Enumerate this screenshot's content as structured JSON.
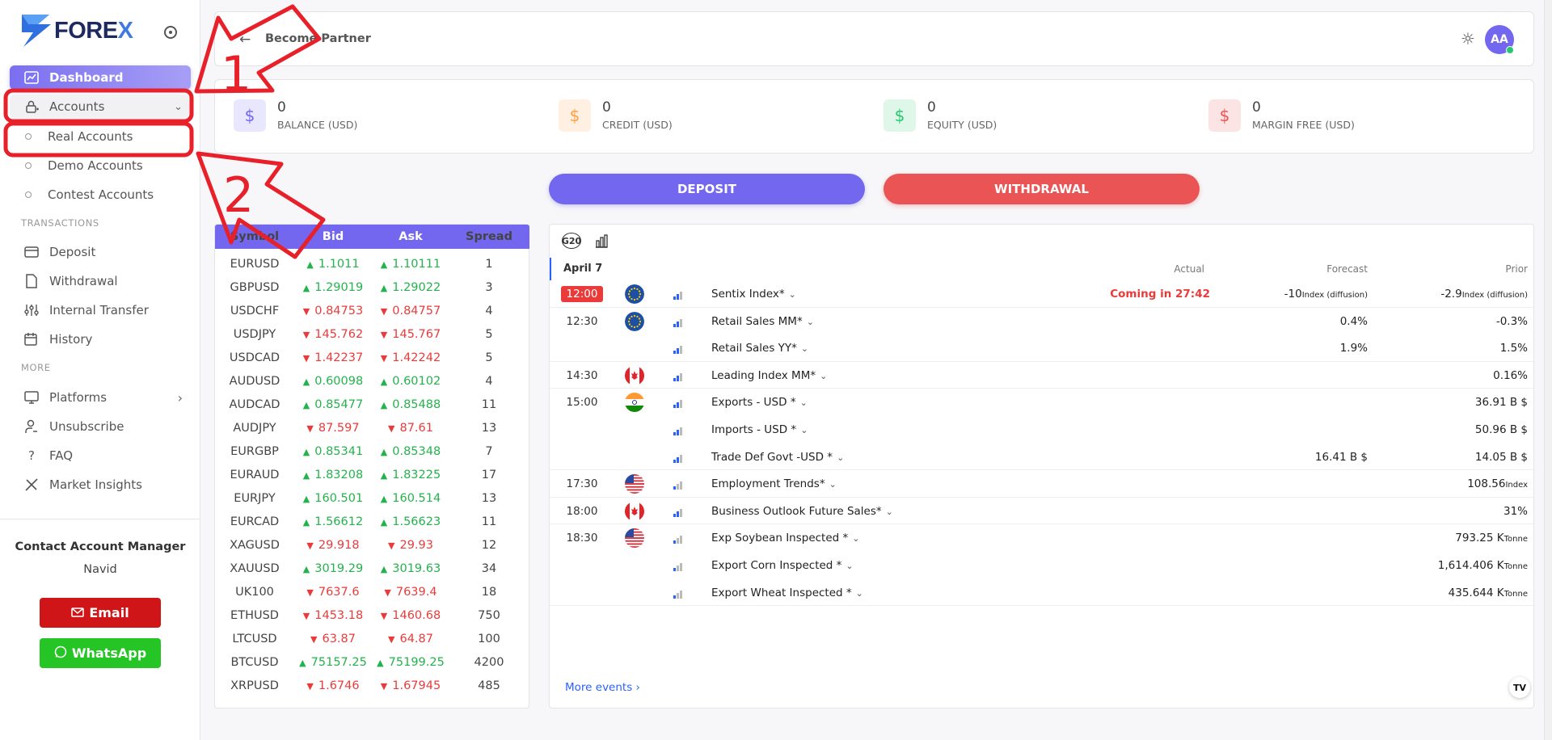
{
  "app": {
    "logo_text_main": "FORE",
    "logo_text_x": "X"
  },
  "sidebar": {
    "dashboard": "Dashboard",
    "accounts": "Accounts",
    "accounts_sub": [
      "Real Accounts",
      "Demo Accounts",
      "Contest Accounts"
    ],
    "transactions_label": "TRANSACTIONS",
    "transactions": [
      "Deposit",
      "Withdrawal",
      "Internal Transfer",
      "History"
    ],
    "more_label": "MORE",
    "more": [
      "Platforms",
      "Unsubscribe",
      "FAQ",
      "Market Insights"
    ],
    "contact_title": "Contact Account Manager",
    "contact_name": "Navid",
    "email_label": "Email",
    "whatsapp_label": "WhatsApp"
  },
  "topbar": {
    "become_partner": "Become Partner",
    "avatar_initials": "AA"
  },
  "stats": [
    {
      "value": "0",
      "label": "BALANCE (USD)",
      "color": "#7367f0",
      "bg": "#e9e7fd"
    },
    {
      "value": "0",
      "label": "CREDIT (USD)",
      "color": "#ff9f43",
      "bg": "#fff0e1"
    },
    {
      "value": "0",
      "label": "EQUITY (USD)",
      "color": "#28c76f",
      "bg": "#dff7e9"
    },
    {
      "value": "0",
      "label": "MARGIN FREE (USD)",
      "color": "#ea5455",
      "bg": "#fce4e4"
    }
  ],
  "actions": {
    "deposit": "DEPOSIT",
    "withdrawal": "WITHDRAWAL"
  },
  "quotes": {
    "headers": [
      "Symbol",
      "Bid",
      "Ask",
      "Spread"
    ],
    "rows": [
      {
        "symbol": "EURUSD",
        "bid": "1.1011",
        "ask": "1.10111",
        "spread": "1",
        "dir": "up"
      },
      {
        "symbol": "GBPUSD",
        "bid": "1.29019",
        "ask": "1.29022",
        "spread": "3",
        "dir": "up"
      },
      {
        "symbol": "USDCHF",
        "bid": "0.84753",
        "ask": "0.84757",
        "spread": "4",
        "dir": "down"
      },
      {
        "symbol": "USDJPY",
        "bid": "145.762",
        "ask": "145.767",
        "spread": "5",
        "dir": "down"
      },
      {
        "symbol": "USDCAD",
        "bid": "1.42237",
        "ask": "1.42242",
        "spread": "5",
        "dir": "down"
      },
      {
        "symbol": "AUDUSD",
        "bid": "0.60098",
        "ask": "0.60102",
        "spread": "4",
        "dir": "up"
      },
      {
        "symbol": "AUDCAD",
        "bid": "0.85477",
        "ask": "0.85488",
        "spread": "11",
        "dir": "up"
      },
      {
        "symbol": "AUDJPY",
        "bid": "87.597",
        "ask": "87.61",
        "spread": "13",
        "dir": "down"
      },
      {
        "symbol": "EURGBP",
        "bid": "0.85341",
        "ask": "0.85348",
        "spread": "7",
        "dir": "up"
      },
      {
        "symbol": "EURAUD",
        "bid": "1.83208",
        "ask": "1.83225",
        "spread": "17",
        "dir": "up"
      },
      {
        "symbol": "EURJPY",
        "bid": "160.501",
        "ask": "160.514",
        "spread": "13",
        "dir": "up"
      },
      {
        "symbol": "EURCAD",
        "bid": "1.56612",
        "ask": "1.56623",
        "spread": "11",
        "dir": "up"
      },
      {
        "symbol": "XAGUSD",
        "bid": "29.918",
        "ask": "29.93",
        "spread": "12",
        "dir": "down"
      },
      {
        "symbol": "XAUUSD",
        "bid": "3019.29",
        "ask": "3019.63",
        "spread": "34",
        "dir": "up"
      },
      {
        "symbol": "UK100",
        "bid": "7637.6",
        "ask": "7639.4",
        "spread": "18",
        "dir": "down"
      },
      {
        "symbol": "ETHUSD",
        "bid": "1453.18",
        "ask": "1460.68",
        "spread": "750",
        "dir": "down"
      },
      {
        "symbol": "LTCUSD",
        "bid": "63.87",
        "ask": "64.87",
        "spread": "100",
        "dir": "down"
      },
      {
        "symbol": "BTCUSD",
        "bid": "75157.25",
        "ask": "75199.25",
        "spread": "4200",
        "dir": "up"
      },
      {
        "symbol": "XRPUSD",
        "bid": "1.6746",
        "ask": "1.67945",
        "spread": "485",
        "dir": "down"
      }
    ]
  },
  "calendar": {
    "g20": "G20",
    "date": "April 7",
    "col_actual": "Actual",
    "col_forecast": "Forecast",
    "col_prior": "Prior",
    "more_events": "More events",
    "events": [
      {
        "time": "12:00",
        "flag": "eu",
        "bars": 2,
        "name": "Sentix Index*",
        "actual": "Coming in 27:42",
        "forecast": "-10",
        "forecast_unit": "Index (diffusion)",
        "prior": "-2.9",
        "prior_unit": "Index (diffusion)"
      },
      {
        "time": "12:30",
        "flag": "eu",
        "bars": 2,
        "name": "Retail Sales MM*",
        "actual": "",
        "forecast": "0.4%",
        "forecast_unit": "",
        "prior": "-0.3%",
        "prior_unit": ""
      },
      {
        "time": "",
        "flag": "",
        "bars": 2,
        "name": "Retail Sales YY*",
        "actual": "",
        "forecast": "1.9%",
        "forecast_unit": "",
        "prior": "1.5%",
        "prior_unit": ""
      },
      {
        "time": "14:30",
        "flag": "ca",
        "bars": 2,
        "name": "Leading Index MM*",
        "actual": "",
        "forecast": "",
        "forecast_unit": "",
        "prior": "0.16%",
        "prior_unit": ""
      },
      {
        "time": "15:00",
        "flag": "in",
        "bars": 2,
        "name": "Exports - USD *",
        "actual": "",
        "forecast": "",
        "forecast_unit": "",
        "prior": "36.91 B $",
        "prior_unit": ""
      },
      {
        "time": "",
        "flag": "",
        "bars": 2,
        "name": "Imports - USD *",
        "actual": "",
        "forecast": "",
        "forecast_unit": "",
        "prior": "50.96 B $",
        "prior_unit": ""
      },
      {
        "time": "",
        "flag": "",
        "bars": 2,
        "name": "Trade Def Govt -USD *",
        "actual": "",
        "forecast": "16.41 B $",
        "forecast_unit": "",
        "prior": "14.05 B $",
        "prior_unit": ""
      },
      {
        "time": "17:30",
        "flag": "us",
        "bars": 1,
        "name": "Employment Trends*",
        "actual": "",
        "forecast": "",
        "forecast_unit": "",
        "prior": "108.56",
        "prior_unit": "Index"
      },
      {
        "time": "18:00",
        "flag": "ca",
        "bars": 2,
        "name": "Business Outlook Future Sales*",
        "actual": "",
        "forecast": "",
        "forecast_unit": "",
        "prior": "31%",
        "prior_unit": ""
      },
      {
        "time": "18:30",
        "flag": "us",
        "bars": 1,
        "name": "Exp Soybean Inspected *",
        "actual": "",
        "forecast": "",
        "forecast_unit": "",
        "prior": "793.25 K",
        "prior_unit": "Tonne"
      },
      {
        "time": "",
        "flag": "",
        "bars": 1,
        "name": "Export Corn Inspected *",
        "actual": "",
        "forecast": "",
        "forecast_unit": "",
        "prior": "1,614.406 K",
        "prior_unit": "Tonne"
      },
      {
        "time": "",
        "flag": "",
        "bars": 1,
        "name": "Export Wheat Inspected *",
        "actual": "",
        "forecast": "",
        "forecast_unit": "",
        "prior": "435.644 K",
        "prior_unit": "Tonne"
      }
    ]
  },
  "annotations": {
    "label_1": "1",
    "label_2": "2"
  }
}
